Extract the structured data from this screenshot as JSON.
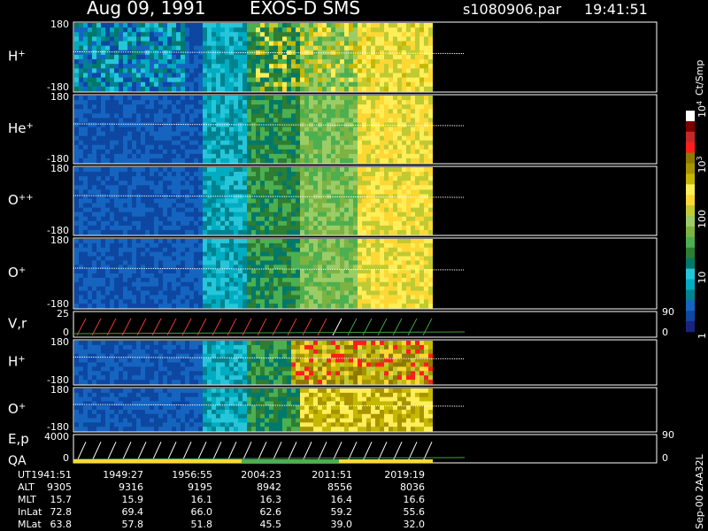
{
  "header": {
    "date": "Aug 09, 1991",
    "instrument": "EXOS-D SMS",
    "file": "s1080906.par",
    "time": "19:41:51"
  },
  "colorbar": {
    "unit": "Ct/Smp",
    "labels": [
      {
        "text": "1",
        "value": 1
      },
      {
        "text": "10",
        "value": 10
      },
      {
        "text": "100",
        "value": 100
      },
      {
        "text": "10",
        "sup": "3",
        "value": 1000
      },
      {
        "text": "10",
        "sup": "4",
        "value": 10000
      }
    ],
    "colors": [
      "#1a237e",
      "#0d47a1",
      "#1565c0",
      "#00838f",
      "#00acc1",
      "#26c6da",
      "#00796b",
      "#2e7d32",
      "#4caf50",
      "#7cb342",
      "#9ccc65",
      "#c0ca33",
      "#fdd835",
      "#ffee58",
      "#c6b800",
      "#a89400",
      "#8d7a00",
      "#ff1e1e",
      "#c62828",
      "#7b0000",
      "#ffffff"
    ]
  },
  "footer": {
    "stamp": "Sep-00  2AA32L",
    "row_labels": [
      "UT",
      "ALT",
      "MLT",
      "InLat",
      "MLat"
    ],
    "columns": [
      {
        "UT": "1941:51",
        "ALT": "9305",
        "MLT": "15.7",
        "InLat": "72.8",
        "MLat": "63.8"
      },
      {
        "UT": "1949:27",
        "ALT": "9316",
        "MLT": "15.9",
        "InLat": "69.4",
        "MLat": "57.8"
      },
      {
        "UT": "1956:55",
        "ALT": "9195",
        "MLT": "16.1",
        "InLat": "66.0",
        "MLat": "51.8"
      },
      {
        "UT": "2004:23",
        "ALT": "8942",
        "MLT": "16.3",
        "InLat": "62.6",
        "MLat": "45.5"
      },
      {
        "UT": "2011:51",
        "ALT": "8556",
        "MLT": "16.4",
        "InLat": "59.2",
        "MLat": "39.0"
      },
      {
        "UT": "2019:19",
        "ALT": "8036",
        "MLT": "16.6",
        "InLat": "55.6",
        "MLat": "32.0"
      }
    ]
  },
  "chart_data": {
    "type": "heatmap",
    "panels": [
      {
        "label": "H",
        "sup": "+",
        "ymin": "-180",
        "ymax": "180",
        "band": "mixed"
      },
      {
        "label": "He",
        "sup": "+",
        "ymin": "-180",
        "ymax": "180",
        "band": "smooth"
      },
      {
        "label": "O",
        "sup": "++",
        "ymin": "-180",
        "ymax": "180",
        "band": "smooth"
      },
      {
        "label": "O",
        "sup": "+",
        "ymin": "-180",
        "ymax": "180",
        "band": "smooth"
      },
      {
        "label": "V,r",
        "sup": "",
        "ymin": "0",
        "ymax": "25",
        "band": "lines",
        "right_max": "90",
        "right_min": "0"
      },
      {
        "label": "H",
        "sup": "+",
        "ymin": "-180",
        "ymax": "180",
        "band": "bright"
      },
      {
        "label": "O",
        "sup": "+",
        "ymin": "-180",
        "ymax": "180",
        "band": "smooth2"
      },
      {
        "label": "E,p",
        "sup": "",
        "label2": "QA",
        "ymin": "0",
        "ymax": "4000",
        "band": "lines2",
        "right_max": "90",
        "right_min": "0"
      }
    ],
    "colorbar_scale": "log",
    "colorbar_range": [
      1,
      10000
    ]
  }
}
